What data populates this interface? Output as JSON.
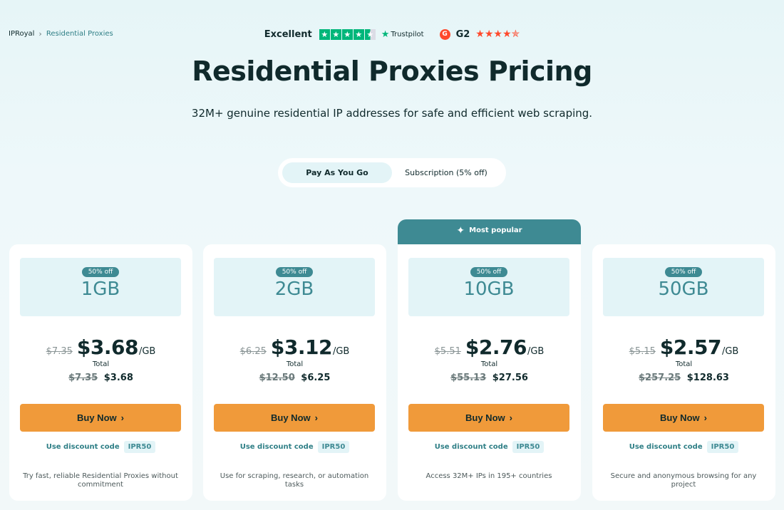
{
  "breadcrumb": {
    "home": "IPRoyal",
    "separator": "›",
    "current": "Residential Proxies"
  },
  "ratings": {
    "trustpilot_label": "Excellent",
    "trustpilot_brand": "Trustpilot",
    "trustpilot_stars": 4.5,
    "g2_logo": "G",
    "g2_brand": "G2",
    "g2_stars": "★★★★✯",
    "colors": {
      "trustpilot": "#00b67a",
      "g2": "#ff492c"
    }
  },
  "title": "Residential Proxies Pricing",
  "subtitle": "32M+ genuine residential IP addresses for safe and efficient web scraping.",
  "billing_toggle": {
    "options": [
      "Pay As You Go",
      "Subscription (5% off)"
    ],
    "selected": "Pay As You Go"
  },
  "popular_label": "Most popular",
  "cards": [
    {
      "badge": "50% off",
      "size": "1GB",
      "old_price": "$7.35",
      "price": "$3.68",
      "unit": "/GB",
      "total_label": "Total",
      "old_total": "$7.35",
      "total": "$3.68",
      "button": "Buy Now",
      "discount_label": "Use discount code",
      "discount_code": "IPR50",
      "description": "Try fast, reliable Residential Proxies without commitment"
    },
    {
      "badge": "50% off",
      "size": "2GB",
      "old_price": "$6.25",
      "price": "$3.12",
      "unit": "/GB",
      "total_label": "Total",
      "old_total": "$12.50",
      "total": "$6.25",
      "button": "Buy Now",
      "discount_label": "Use discount code",
      "discount_code": "IPR50",
      "description": "Use for scraping, research, or automation tasks"
    },
    {
      "badge": "50% off",
      "size": "10GB",
      "old_price": "$5.51",
      "price": "$2.76",
      "unit": "/GB",
      "total_label": "Total",
      "old_total": "$55.13",
      "total": "$27.56",
      "button": "Buy Now",
      "discount_label": "Use discount code",
      "discount_code": "IPR50",
      "description": "Access 32M+ IPs in 195+ countries"
    },
    {
      "badge": "50% off",
      "size": "50GB",
      "old_price": "$5.15",
      "price": "$2.57",
      "unit": "/GB",
      "total_label": "Total",
      "old_total": "$257.25",
      "total": "$128.63",
      "button": "Buy Now",
      "discount_label": "Use discount code",
      "discount_code": "IPR50",
      "description": "Secure and anonymous browsing for any project"
    }
  ],
  "colors": {
    "accent": "#3e8a93",
    "button": "#f09a3a",
    "light_teal": "#e3f4f7",
    "text": "#102a2c"
  }
}
